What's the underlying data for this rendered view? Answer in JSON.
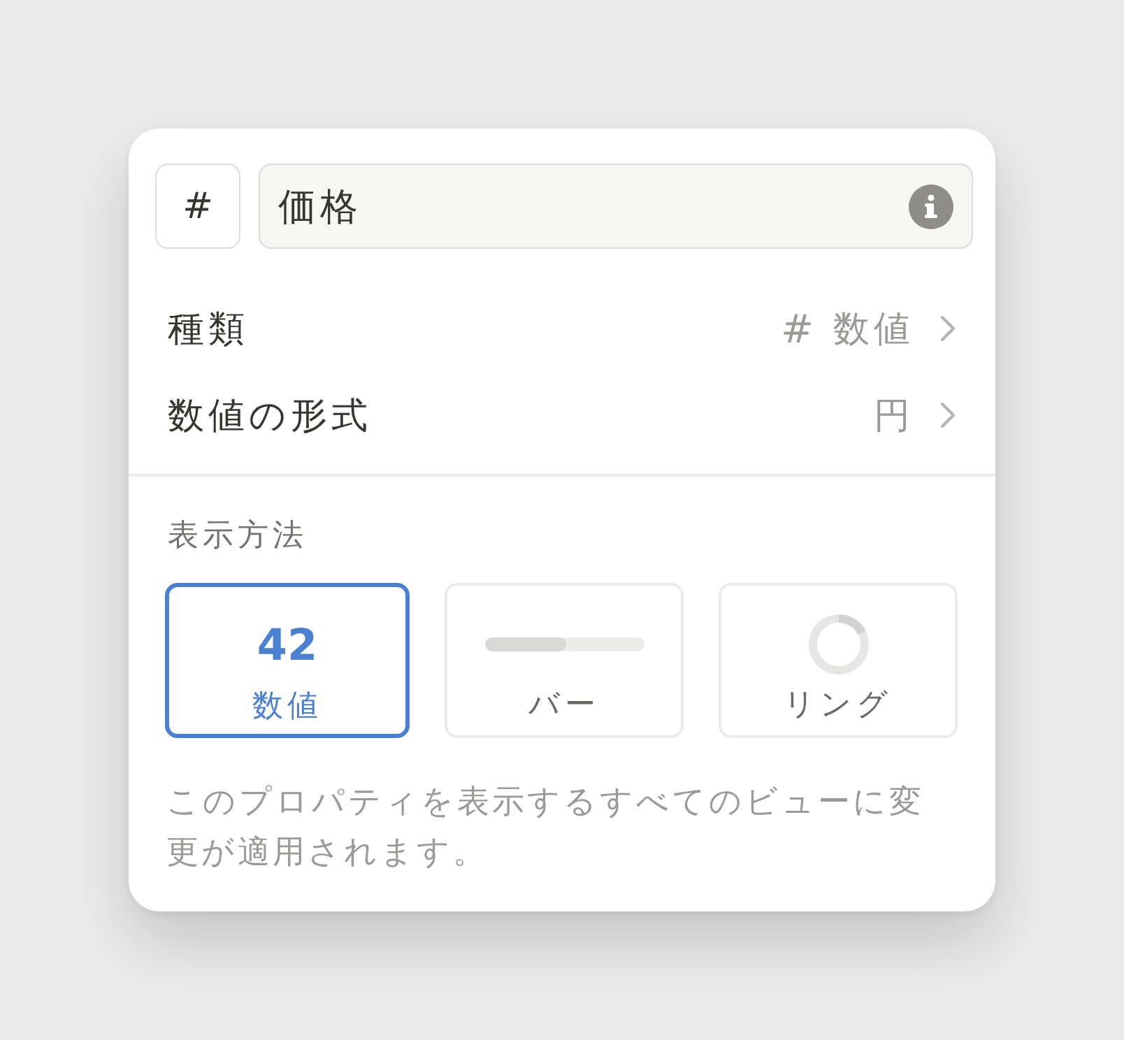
{
  "header": {
    "type_button": "#",
    "name_field": {
      "value": "価格"
    }
  },
  "settings": [
    {
      "label": "種類",
      "value_symbol": "#",
      "value": "数値"
    },
    {
      "label": "数値の形式",
      "value": "円"
    }
  ],
  "display": {
    "title": "表示方法",
    "options": [
      {
        "kind": "number",
        "preview": "42",
        "label": "数値",
        "selected": true
      },
      {
        "kind": "bar",
        "label": "バー",
        "selected": false
      },
      {
        "kind": "ring",
        "label": "リング",
        "selected": false
      }
    ]
  },
  "note": "このプロパティを表示するすべてのビューに変更が適用されます。"
}
